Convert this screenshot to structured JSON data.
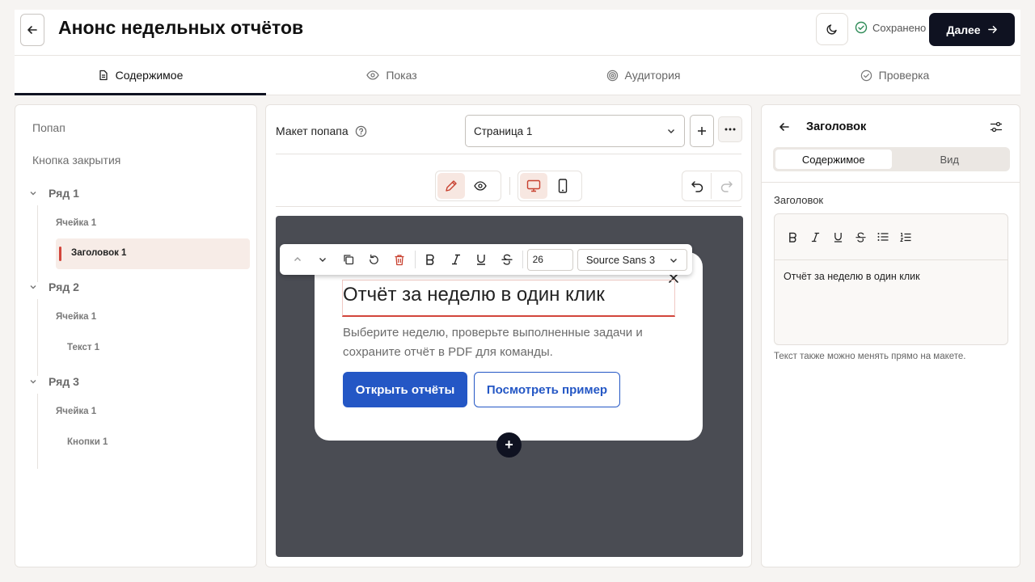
{
  "header": {
    "title": "Анонс недельных отчётов",
    "saved_label": "Сохранено",
    "next_label": "Далее"
  },
  "tabs": [
    {
      "label": "Содержимое",
      "icon": "document-icon",
      "active": true
    },
    {
      "label": "Показ",
      "icon": "eye-icon",
      "active": false
    },
    {
      "label": "Аудитория",
      "icon": "target-icon",
      "active": false
    },
    {
      "label": "Проверка",
      "icon": "check-circle-icon",
      "active": false
    }
  ],
  "tree": {
    "popup": "Попап",
    "close_button": "Кнопка закрытия",
    "rows": [
      {
        "label": "Ряд 1",
        "cell": "Ячейка 1",
        "child": "Заголовок 1"
      },
      {
        "label": "Ряд 2",
        "cell": "Ячейка 1",
        "child": "Текст 1"
      },
      {
        "label": "Ряд 3",
        "cell": "Ячейка 1",
        "child": "Кнопки 1"
      }
    ]
  },
  "layout": {
    "label": "Макет попапа",
    "page_select": "Страница 1"
  },
  "toolbar": {
    "font_size": "26",
    "font_family": "Source Sans 3"
  },
  "popup": {
    "headline": "Отчёт за неделю в один клик",
    "body": "Выберите неделю, проверьте выполненные задачи и сохраните отчёт в PDF для команды.",
    "primary_button": "Открыть отчёты",
    "secondary_button": "Посмотреть пример",
    "add_symbol": "+"
  },
  "inspector": {
    "title": "Заголовок",
    "seg_content": "Содержимое",
    "seg_view": "Вид",
    "field_label": "Заголовок",
    "editor_text": "Отчёт за неделю в один клик",
    "hint": "Текст также можно менять прямо на макете."
  },
  "colors": {
    "accent_red": "#d2453b",
    "primary_blue": "#2457c5",
    "dark": "#0f1221",
    "saved_green": "#2e8b57"
  }
}
